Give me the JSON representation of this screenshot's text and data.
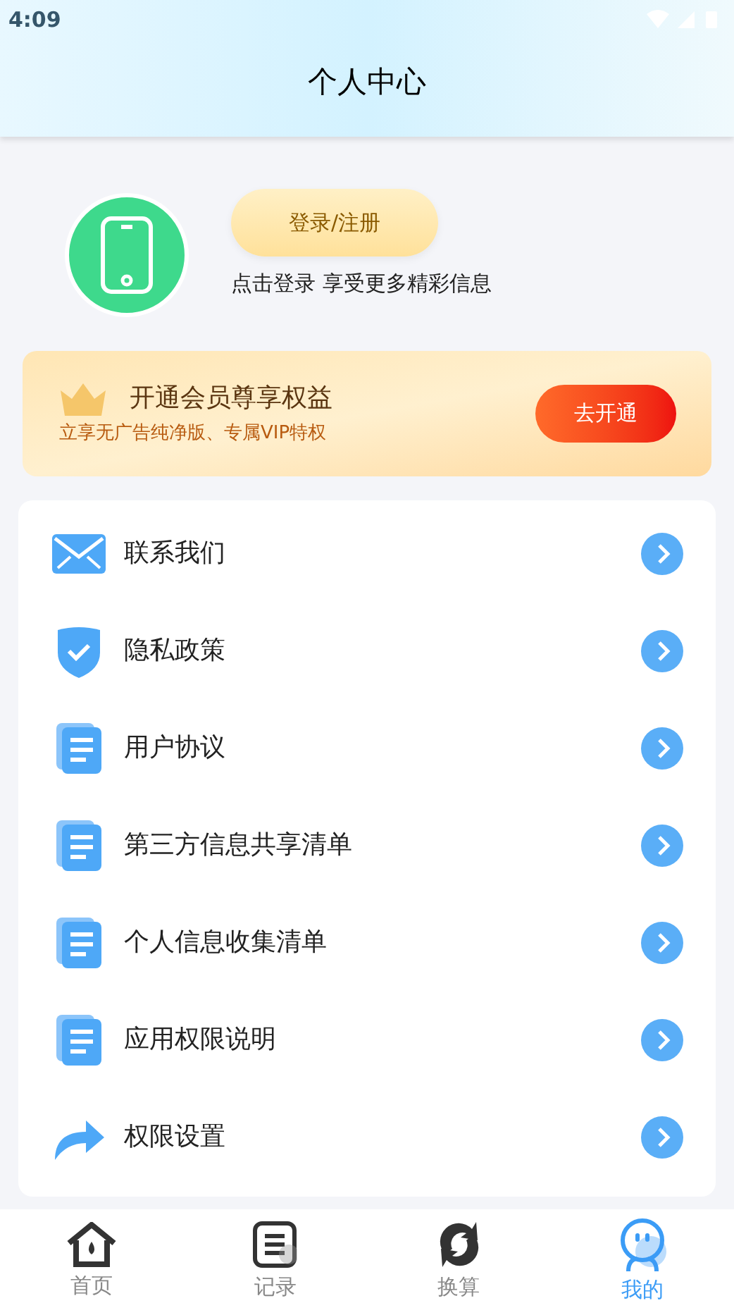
{
  "status_bar": {
    "time": "4:09"
  },
  "header": {
    "title": "个人中心"
  },
  "profile": {
    "login_button": "登录/注册",
    "hint": "点击登录 享受更多精彩信息"
  },
  "vip_banner": {
    "title": "开通会员尊享权益",
    "subtitle": "立享无广告纯净版、专属VIP特权",
    "button": "去开通"
  },
  "menu": [
    {
      "kind": "mail",
      "label": "联系我们"
    },
    {
      "kind": "shield",
      "label": "隐私政策"
    },
    {
      "kind": "document",
      "label": "用户协议"
    },
    {
      "kind": "document",
      "label": "第三方信息共享清单"
    },
    {
      "kind": "document",
      "label": "个人信息收集清单"
    },
    {
      "kind": "document",
      "label": "应用权限说明"
    },
    {
      "kind": "share",
      "label": "权限设置"
    }
  ],
  "tabs": [
    {
      "kind": "home",
      "label": "首页",
      "selected": false
    },
    {
      "kind": "records",
      "label": "记录",
      "selected": false
    },
    {
      "kind": "convert",
      "label": "换算",
      "selected": false
    },
    {
      "kind": "profile",
      "label": "我的",
      "selected": true
    }
  ]
}
